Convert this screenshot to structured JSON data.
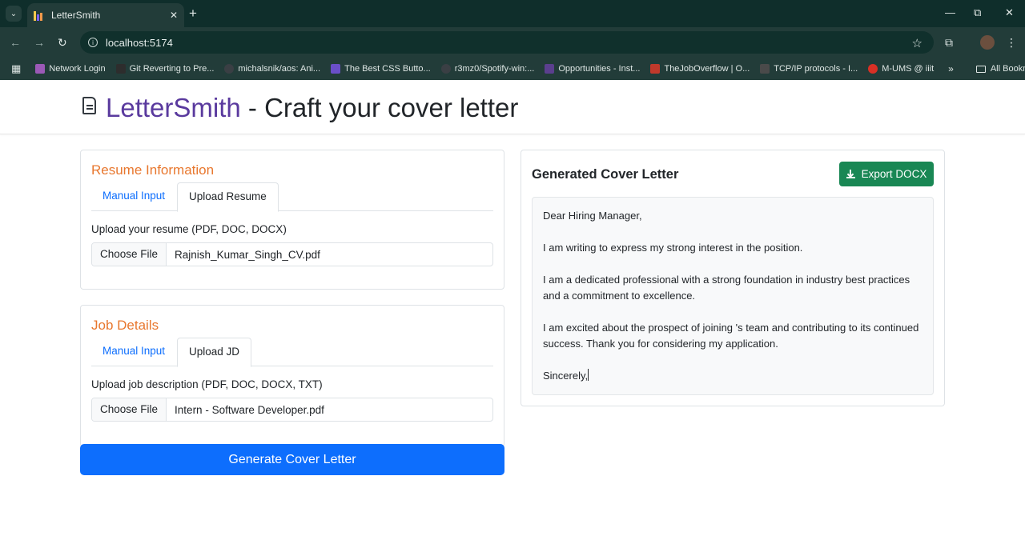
{
  "browser": {
    "tab_title": "LetterSmith",
    "url": "localhost:5174",
    "bookmarks": [
      {
        "label": "Network Login",
        "color": "#9b59b6"
      },
      {
        "label": "Git Reverting to Pre...",
        "color": "#2d2d2d"
      },
      {
        "label": "michalsnik/aos: Ani...",
        "color": "#1f2328"
      },
      {
        "label": "The Best CSS Butto...",
        "color": "#6a4fc8"
      },
      {
        "label": "r3mz0/Spotify-win:...",
        "color": "#1f2328"
      },
      {
        "label": "Opportunities - Inst...",
        "color": "#5b3f8e"
      },
      {
        "label": "TheJobOverflow | O...",
        "color": "#c0392b"
      },
      {
        "label": "TCP/IP protocols - I...",
        "color": "#4a4a4a"
      },
      {
        "label": "M-UMS @ iiit",
        "color": "#d93025"
      }
    ],
    "all_bookmarks": "All Bookmarks"
  },
  "header": {
    "brand": "LetterSmith",
    "subtitle": " - Craft your cover letter"
  },
  "resume": {
    "title": "Resume Information",
    "tab_manual": "Manual Input",
    "tab_upload": "Upload Resume",
    "active_tab": "Upload Resume",
    "upload_label": "Upload your resume (PDF, DOC, DOCX)",
    "choose_file": "Choose File",
    "file_name": "Rajnish_Kumar_Singh_CV.pdf"
  },
  "job": {
    "title": "Job Details",
    "tab_manual": "Manual Input",
    "tab_upload": "Upload JD",
    "active_tab": "Upload JD",
    "upload_label": "Upload job description (PDF, DOC, DOCX, TXT)",
    "choose_file": "Choose File",
    "file_name": "Intern - Software Developer.pdf"
  },
  "generate_button": "Generate Cover Letter",
  "result": {
    "title": "Generated Cover Letter",
    "export_button": "Export DOCX",
    "letter": {
      "greeting": "Dear Hiring Manager,",
      "p1": "I am writing to express my strong interest in the position.",
      "p2": "I am a dedicated professional with a strong foundation in industry best practices and a commitment to excellence.",
      "p3": "I am excited about the prospect of joining 's team and contributing to its continued success. Thank you for considering my application.",
      "closing": "Sincerely,"
    }
  },
  "colors": {
    "brand": "#5a3a9e",
    "section_title": "#e8772e",
    "primary": "#0d6efd",
    "success": "#198754"
  }
}
